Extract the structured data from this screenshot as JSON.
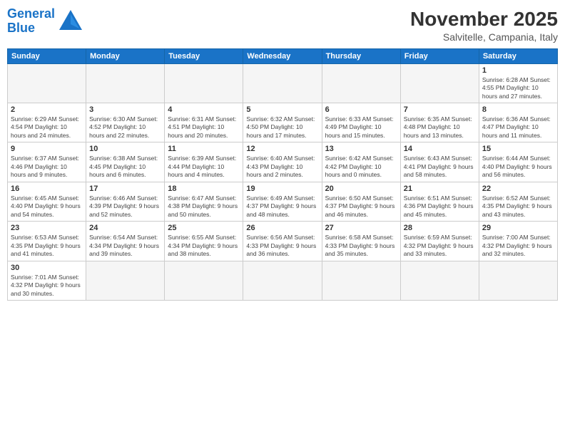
{
  "header": {
    "logo_general": "General",
    "logo_blue": "Blue",
    "title": "November 2025",
    "subtitle": "Salvitelle, Campania, Italy"
  },
  "weekdays": [
    "Sunday",
    "Monday",
    "Tuesday",
    "Wednesday",
    "Thursday",
    "Friday",
    "Saturday"
  ],
  "weeks": [
    [
      {
        "day": "",
        "info": ""
      },
      {
        "day": "",
        "info": ""
      },
      {
        "day": "",
        "info": ""
      },
      {
        "day": "",
        "info": ""
      },
      {
        "day": "",
        "info": ""
      },
      {
        "day": "",
        "info": ""
      },
      {
        "day": "1",
        "info": "Sunrise: 6:28 AM\nSunset: 4:55 PM\nDaylight: 10 hours and 27 minutes."
      }
    ],
    [
      {
        "day": "2",
        "info": "Sunrise: 6:29 AM\nSunset: 4:54 PM\nDaylight: 10 hours and 24 minutes."
      },
      {
        "day": "3",
        "info": "Sunrise: 6:30 AM\nSunset: 4:52 PM\nDaylight: 10 hours and 22 minutes."
      },
      {
        "day": "4",
        "info": "Sunrise: 6:31 AM\nSunset: 4:51 PM\nDaylight: 10 hours and 20 minutes."
      },
      {
        "day": "5",
        "info": "Sunrise: 6:32 AM\nSunset: 4:50 PM\nDaylight: 10 hours and 17 minutes."
      },
      {
        "day": "6",
        "info": "Sunrise: 6:33 AM\nSunset: 4:49 PM\nDaylight: 10 hours and 15 minutes."
      },
      {
        "day": "7",
        "info": "Sunrise: 6:35 AM\nSunset: 4:48 PM\nDaylight: 10 hours and 13 minutes."
      },
      {
        "day": "8",
        "info": "Sunrise: 6:36 AM\nSunset: 4:47 PM\nDaylight: 10 hours and 11 minutes."
      }
    ],
    [
      {
        "day": "9",
        "info": "Sunrise: 6:37 AM\nSunset: 4:46 PM\nDaylight: 10 hours and 9 minutes."
      },
      {
        "day": "10",
        "info": "Sunrise: 6:38 AM\nSunset: 4:45 PM\nDaylight: 10 hours and 6 minutes."
      },
      {
        "day": "11",
        "info": "Sunrise: 6:39 AM\nSunset: 4:44 PM\nDaylight: 10 hours and 4 minutes."
      },
      {
        "day": "12",
        "info": "Sunrise: 6:40 AM\nSunset: 4:43 PM\nDaylight: 10 hours and 2 minutes."
      },
      {
        "day": "13",
        "info": "Sunrise: 6:42 AM\nSunset: 4:42 PM\nDaylight: 10 hours and 0 minutes."
      },
      {
        "day": "14",
        "info": "Sunrise: 6:43 AM\nSunset: 4:41 PM\nDaylight: 9 hours and 58 minutes."
      },
      {
        "day": "15",
        "info": "Sunrise: 6:44 AM\nSunset: 4:40 PM\nDaylight: 9 hours and 56 minutes."
      }
    ],
    [
      {
        "day": "16",
        "info": "Sunrise: 6:45 AM\nSunset: 4:40 PM\nDaylight: 9 hours and 54 minutes."
      },
      {
        "day": "17",
        "info": "Sunrise: 6:46 AM\nSunset: 4:39 PM\nDaylight: 9 hours and 52 minutes."
      },
      {
        "day": "18",
        "info": "Sunrise: 6:47 AM\nSunset: 4:38 PM\nDaylight: 9 hours and 50 minutes."
      },
      {
        "day": "19",
        "info": "Sunrise: 6:49 AM\nSunset: 4:37 PM\nDaylight: 9 hours and 48 minutes."
      },
      {
        "day": "20",
        "info": "Sunrise: 6:50 AM\nSunset: 4:37 PM\nDaylight: 9 hours and 46 minutes."
      },
      {
        "day": "21",
        "info": "Sunrise: 6:51 AM\nSunset: 4:36 PM\nDaylight: 9 hours and 45 minutes."
      },
      {
        "day": "22",
        "info": "Sunrise: 6:52 AM\nSunset: 4:35 PM\nDaylight: 9 hours and 43 minutes."
      }
    ],
    [
      {
        "day": "23",
        "info": "Sunrise: 6:53 AM\nSunset: 4:35 PM\nDaylight: 9 hours and 41 minutes."
      },
      {
        "day": "24",
        "info": "Sunrise: 6:54 AM\nSunset: 4:34 PM\nDaylight: 9 hours and 39 minutes."
      },
      {
        "day": "25",
        "info": "Sunrise: 6:55 AM\nSunset: 4:34 PM\nDaylight: 9 hours and 38 minutes."
      },
      {
        "day": "26",
        "info": "Sunrise: 6:56 AM\nSunset: 4:33 PM\nDaylight: 9 hours and 36 minutes."
      },
      {
        "day": "27",
        "info": "Sunrise: 6:58 AM\nSunset: 4:33 PM\nDaylight: 9 hours and 35 minutes."
      },
      {
        "day": "28",
        "info": "Sunrise: 6:59 AM\nSunset: 4:32 PM\nDaylight: 9 hours and 33 minutes."
      },
      {
        "day": "29",
        "info": "Sunrise: 7:00 AM\nSunset: 4:32 PM\nDaylight: 9 hours and 32 minutes."
      }
    ],
    [
      {
        "day": "30",
        "info": "Sunrise: 7:01 AM\nSunset: 4:32 PM\nDaylight: 9 hours and 30 minutes."
      },
      {
        "day": "",
        "info": ""
      },
      {
        "day": "",
        "info": ""
      },
      {
        "day": "",
        "info": ""
      },
      {
        "day": "",
        "info": ""
      },
      {
        "day": "",
        "info": ""
      },
      {
        "day": "",
        "info": ""
      }
    ]
  ]
}
